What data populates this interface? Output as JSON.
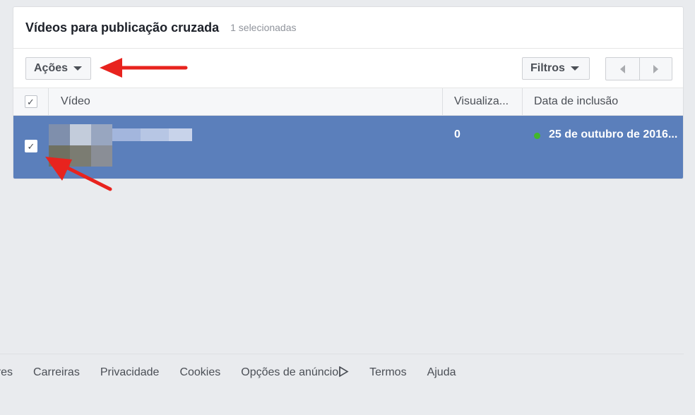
{
  "panel": {
    "title": "Vídeos para publicação cruzada",
    "selected_count": "1 selecionadas"
  },
  "toolbar": {
    "actions_label": "Ações",
    "filters_label": "Filtros",
    "pager_prev_icon": "chevron-left-icon",
    "pager_next_icon": "chevron-right-icon"
  },
  "table": {
    "headers": {
      "check": "✓",
      "video": "Vídeo",
      "views": "Visualiza...",
      "date": "Data de inclusão"
    },
    "rows": [
      {
        "selected": true,
        "check": "✓",
        "views": "0",
        "status_color": "#42b72a",
        "date": "25 de outubro de 2016..."
      }
    ]
  },
  "footer": {
    "links": [
      "dores",
      "Carreiras",
      "Privacidade",
      "Cookies",
      "Opções de anúncio",
      "Termos",
      "Ajuda"
    ]
  },
  "colors": {
    "selected_row": "#5b7fbb",
    "annotation_arrow": "#e8231e",
    "background": "#e9ebee"
  }
}
